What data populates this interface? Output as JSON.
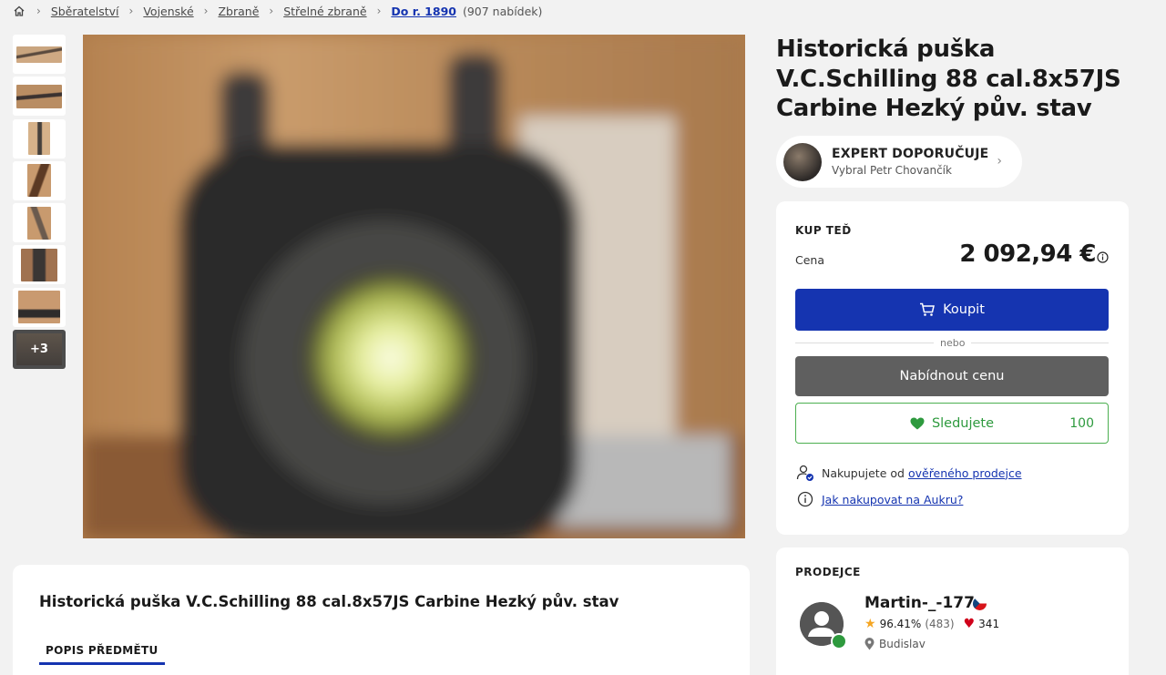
{
  "breadcrumb": {
    "items": [
      "Sběratelství",
      "Vojenské",
      "Zbraně",
      "Střelné zbraně"
    ],
    "current": "Do r. 1890",
    "count": "(907 nabídek)"
  },
  "gallery": {
    "more_label": "+3"
  },
  "item": {
    "title": "Historická puška V.C.Schilling 88 cal.8x57JS Carbine Hezký pův. stav"
  },
  "expert": {
    "heading": "EXPERT DOPORUČUJE",
    "subtitle": "Vybral Petr Chovančík"
  },
  "buy": {
    "section_label": "KUP TEĎ",
    "price_label": "Cena",
    "price": "2 092,94 €",
    "buy_button": "Koupit",
    "or_text": "nebo",
    "offer_button": "Nabídnout cenu",
    "watch_label": "Sledujete",
    "watch_count": "100",
    "verified_prefix": "Nakupujete od",
    "verified_link": "ověřeného prodejce",
    "howto_link": "Jak nakupovat na Aukru?"
  },
  "seller": {
    "section_label": "PRODEJCE",
    "name": "Martin-_-177",
    "rating": "96.41%",
    "rating_count": "(483)",
    "likes": "341",
    "location": "Budislav"
  },
  "description": {
    "title": "Historická puška V.C.Schilling 88 cal.8x57JS Carbine Hezký pův. stav",
    "tab": "POPIS PŘEDMĚTU"
  },
  "colors": {
    "primary": "#1534b0",
    "success": "#2e9a3e",
    "offer_button": "#5f5f5f"
  }
}
